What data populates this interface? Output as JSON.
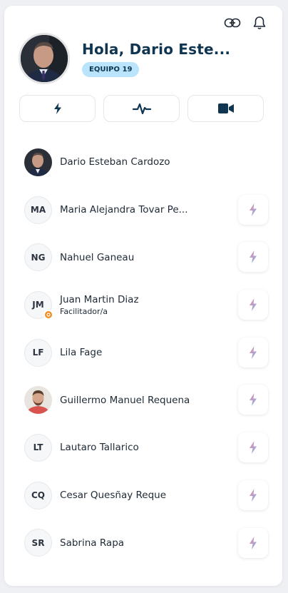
{
  "header": {
    "icons": [
      "link-icon",
      "bell-icon"
    ]
  },
  "profile": {
    "greeting": "Hola, Dario Este...",
    "team_badge": "EQUIPO 19"
  },
  "actions": [
    {
      "name": "quick-action-button",
      "icon": "lightning-icon"
    },
    {
      "name": "activity-button",
      "icon": "pulse-icon"
    },
    {
      "name": "video-call-button",
      "icon": "video-camera-icon"
    }
  ],
  "colors": {
    "primary": "#0f3550",
    "badge_bg": "#b9e4fb",
    "zap_gradient": [
      "#f08aa6",
      "#7fb4ee"
    ],
    "role_dot": "#f28c1f"
  },
  "members": [
    {
      "name": "Dario Esteban Cardozo",
      "initials": "",
      "avatar": "photo",
      "role": "",
      "action": false
    },
    {
      "name": "Maria Alejandra Tovar Pe...",
      "initials": "MA",
      "role": "",
      "action": true
    },
    {
      "name": "Nahuel Ganeau",
      "initials": "NG",
      "role": "",
      "action": true
    },
    {
      "name": "Juan Martin Diaz",
      "initials": "JM",
      "role": "Facilitador/a",
      "action": true
    },
    {
      "name": "Lila Fage",
      "initials": "LF",
      "role": "",
      "action": true
    },
    {
      "name": "Guillermo Manuel Requena",
      "initials": "",
      "avatar": "photo",
      "role": "",
      "action": true
    },
    {
      "name": "Lautaro Tallarico",
      "initials": "LT",
      "role": "",
      "action": true
    },
    {
      "name": "Cesar Quesñay Reque",
      "initials": "CQ",
      "role": "",
      "action": true
    },
    {
      "name": "Sabrina Rapa",
      "initials": "SR",
      "role": "",
      "action": true
    }
  ]
}
